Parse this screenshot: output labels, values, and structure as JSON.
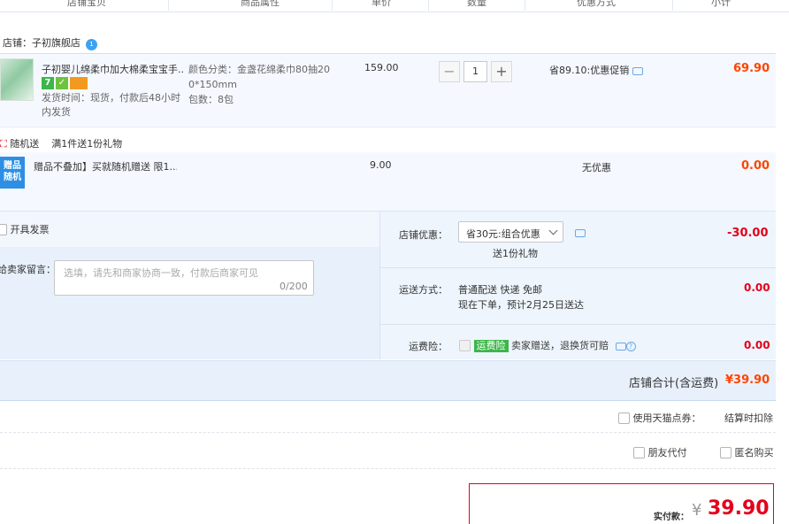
{
  "header": {
    "columns": [
      "店铺宝贝",
      "商品属性",
      "单价",
      "数量",
      "优惠方式",
      "小计"
    ]
  },
  "shop": {
    "label": "店铺：",
    "name": "子初旗舰店"
  },
  "product": {
    "name": "子初婴儿绵柔巾加大棉柔宝宝手...",
    "ship_info": "发货时间：现货，付款后48小时内发货",
    "attr_color": "颜色分类：金盏花绵柔巾80抽200*150mm",
    "attr_pack": "包数：8包",
    "unit_price": "159.00",
    "quantity": "1",
    "qty_minus": "−",
    "qty_plus": "+",
    "discount": "省89.10:优惠促销",
    "subtotal": "69.90",
    "icon_badges": [
      "7",
      "✓",
      ""
    ]
  },
  "gift": {
    "header": "随机送    满1件送1份礼物",
    "tag_line1": "赠品",
    "tag_line2": "随机",
    "name": "赠品不叠加】买就随机赠送 限1...",
    "price": "9.00",
    "discount": "无优惠",
    "subtotal": "0.00"
  },
  "options": {
    "invoice_label": "开具发票",
    "message_label": "给卖家留言：",
    "message_placeholder": "选填，请先和商家协商一致，付款后商家可见",
    "message_count": "0/200",
    "coupon_label": "店铺优惠：",
    "coupon_selected": "省30元:组合优惠",
    "coupon_gift": "送1份礼物",
    "coupon_amount": "-30.00",
    "shipping_label": "运送方式：",
    "shipping_method": "普通配送 快递 免邮",
    "shipping_eta": "现在下单，预计2月25日送达",
    "shipping_amount": "0.00",
    "insurance_label": "运费险：",
    "insurance_tag": "运费险",
    "insurance_text": "卖家赠送，退换货可赔",
    "insurance_amount": "0.00"
  },
  "total": {
    "label": "店铺合计(含运费)",
    "value": "¥39.90"
  },
  "extras": {
    "points_label": "使用天猫点券：",
    "points_note": "结算时扣除",
    "friend_pay": "朋友代付",
    "anonymous": "匿名购买"
  },
  "payment": {
    "label": "实付款：",
    "currency": "¥",
    "amount": "39.90"
  },
  "colors": {
    "accent_red": "#e4001b",
    "price_orange": "#ff4400",
    "brand_blue": "#2d8fe3"
  }
}
